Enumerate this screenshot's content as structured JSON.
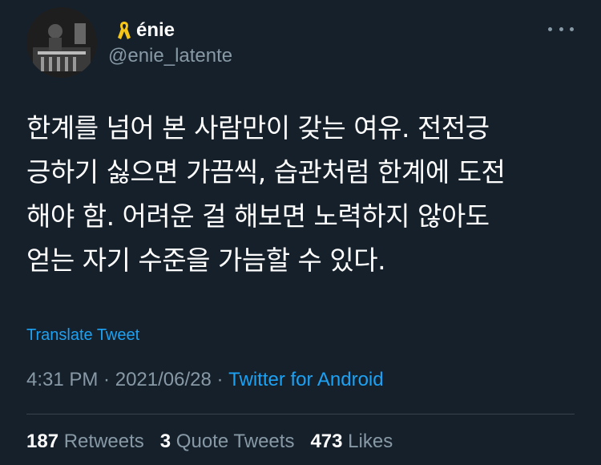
{
  "tweet": {
    "author": {
      "display_name": "énie",
      "handle": "@enie_latente",
      "badge_icon": "yellow-ribbon-icon",
      "avatar": "avatar-image"
    },
    "menu_icon": "more-options-icon",
    "text": "한계를 넘어 본 사람만이 갖는 여유. 전전긍\n긍하기 싫으면 가끔씩, 습관처럼 한계에 도전\n해야 함. 어려운 걸 해보면 노력하지 않아도\n얻는 자기 수준을 가늠할 수 있다.",
    "translate_label": "Translate Tweet",
    "time": "4:31 PM",
    "separator1": " · ",
    "date": "2021/06/28",
    "separator2": " · ",
    "source": "Twitter for Android",
    "stats": {
      "retweets_count": "187",
      "retweets_label": "Retweets",
      "quotes_count": "3",
      "quotes_label": "Quote Tweets",
      "likes_count": "473",
      "likes_label": "Likes"
    }
  },
  "colors": {
    "background": "#15202b",
    "accent": "#1da1f2",
    "muted": "#8899a6",
    "ribbon": "#f5c518"
  }
}
